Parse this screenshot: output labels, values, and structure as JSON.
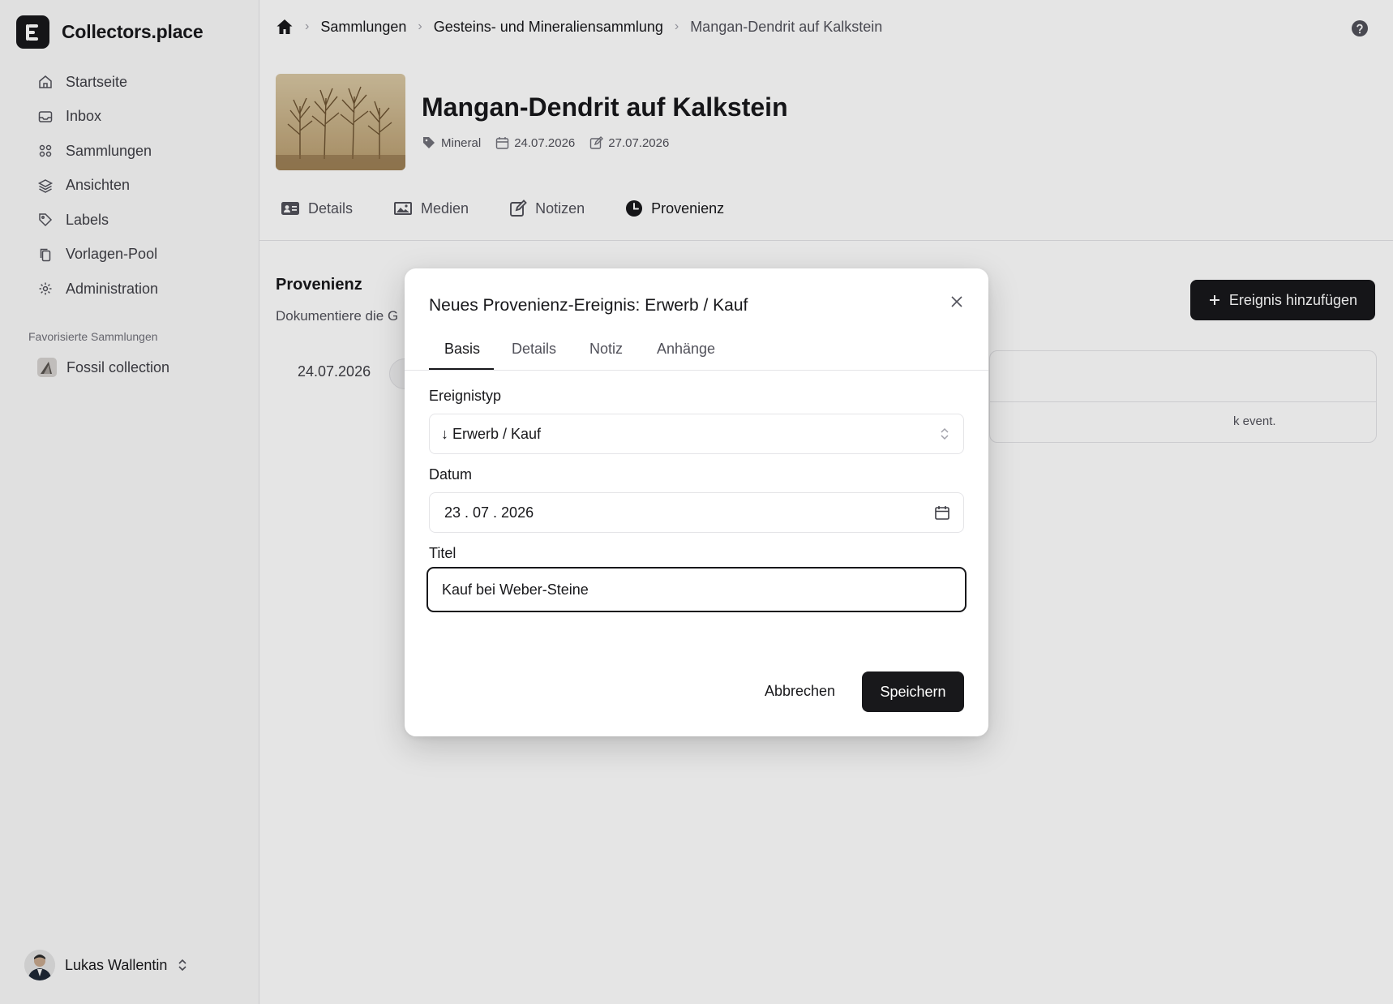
{
  "brand": {
    "name": "Collectors.place"
  },
  "sidebar": {
    "items": [
      {
        "label": "Startseite",
        "icon": "home-icon"
      },
      {
        "label": "Inbox",
        "icon": "inbox-icon"
      },
      {
        "label": "Sammlungen",
        "icon": "grid-icon"
      },
      {
        "label": "Ansichten",
        "icon": "layers-icon"
      },
      {
        "label": "Labels",
        "icon": "tag-icon"
      },
      {
        "label": "Vorlagen-Pool",
        "icon": "copy-icon"
      },
      {
        "label": "Administration",
        "icon": "gear-icon"
      }
    ],
    "favorites_title": "Favorisierte Sammlungen",
    "favorites": [
      {
        "label": "Fossil collection"
      }
    ]
  },
  "user": {
    "name": "Lukas Wallentin"
  },
  "breadcrumb": {
    "items": [
      "Sammlungen",
      "Gesteins- und Mineraliensammlung"
    ],
    "current": "Mangan-Dendrit auf Kalkstein"
  },
  "object": {
    "title": "Mangan-Dendrit auf Kalkstein",
    "category": "Mineral",
    "created": "24.07.2026",
    "modified": "27.07.2026"
  },
  "tabs": [
    {
      "label": "Details"
    },
    {
      "label": "Medien"
    },
    {
      "label": "Notizen"
    },
    {
      "label": "Provenienz"
    }
  ],
  "provenance": {
    "title": "Provenienz",
    "description": "Dokumentiere die G",
    "add_button": "Ereignis hinzufügen",
    "timeline_date": "24.07.2026",
    "card_text": "k event."
  },
  "modal": {
    "title": "Neues Provenienz-Ereignis: Erwerb / Kauf",
    "tabs": [
      "Basis",
      "Details",
      "Notiz",
      "Anhänge"
    ],
    "fields": {
      "type_label": "Ereignistyp",
      "type_value": "↓ Erwerb / Kauf",
      "date_label": "Datum",
      "date_value": "23 . 07 . 2026",
      "title_label": "Titel",
      "title_value": "Kauf bei Weber-Steine"
    },
    "cancel": "Abbrechen",
    "save": "Speichern"
  },
  "colors": {
    "primary": "#18181b",
    "border": "#e4e4e7",
    "muted": "#52525b"
  }
}
